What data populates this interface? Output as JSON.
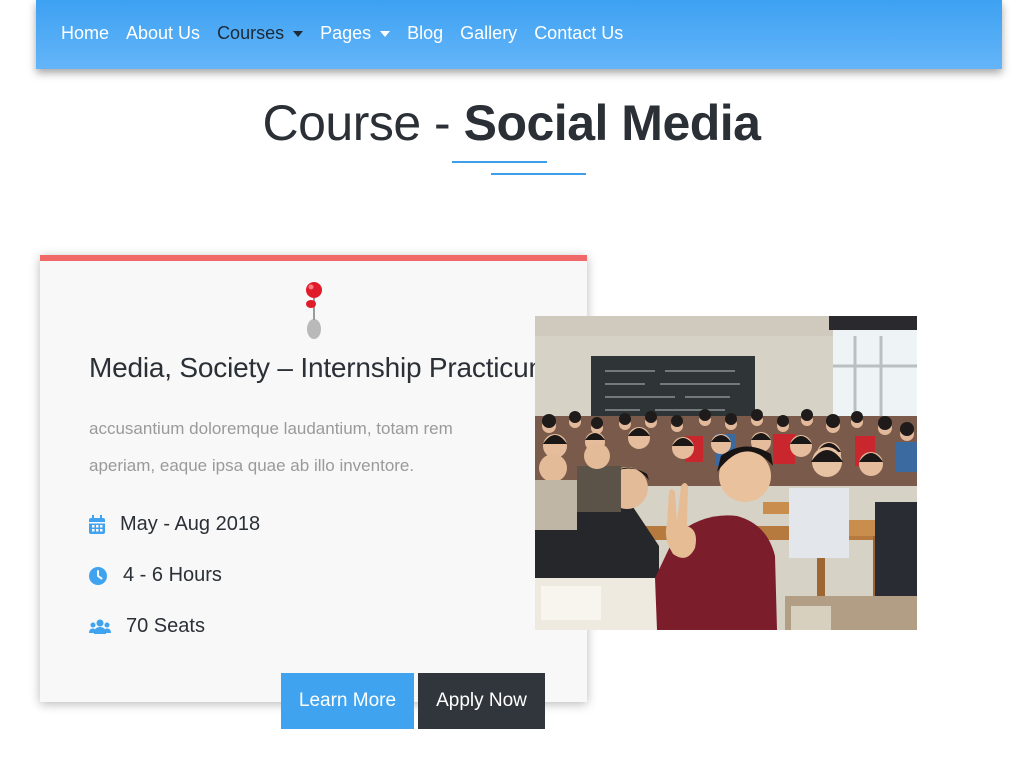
{
  "nav": {
    "items": [
      {
        "label": "Home",
        "dropdown": false,
        "active": false
      },
      {
        "label": "About Us",
        "dropdown": false,
        "active": false
      },
      {
        "label": "Courses",
        "dropdown": true,
        "active": true
      },
      {
        "label": "Pages",
        "dropdown": true,
        "active": false
      },
      {
        "label": "Blog",
        "dropdown": false,
        "active": false
      },
      {
        "label": "Gallery",
        "dropdown": false,
        "active": false
      },
      {
        "label": "Contact Us",
        "dropdown": false,
        "active": false
      }
    ]
  },
  "page": {
    "title_prefix": "Course - ",
    "title_strong": "Social Media"
  },
  "course": {
    "title": "Media, Society – Internship Practicum",
    "description": "accusantium doloremque laudantium, totam rem aperiam, eaque ipsa quae ab illo inventore.",
    "dates": "May - Aug 2018",
    "duration": "4 - 6 Hours",
    "seats": "70 Seats",
    "icons": [
      "calendar-icon",
      "clock-icon",
      "users-icon",
      "pushpin-icon"
    ]
  },
  "buttons": {
    "learn_more": "Learn More",
    "apply_now": "Apply Now"
  },
  "colors": {
    "nav_gradient_top": "#3da1f2",
    "nav_gradient_bottom": "#64b5f8",
    "card_accent": "#f16868",
    "primary_blue": "#3fa3ef",
    "dark_button": "#31363c",
    "heading": "#2b3036"
  }
}
